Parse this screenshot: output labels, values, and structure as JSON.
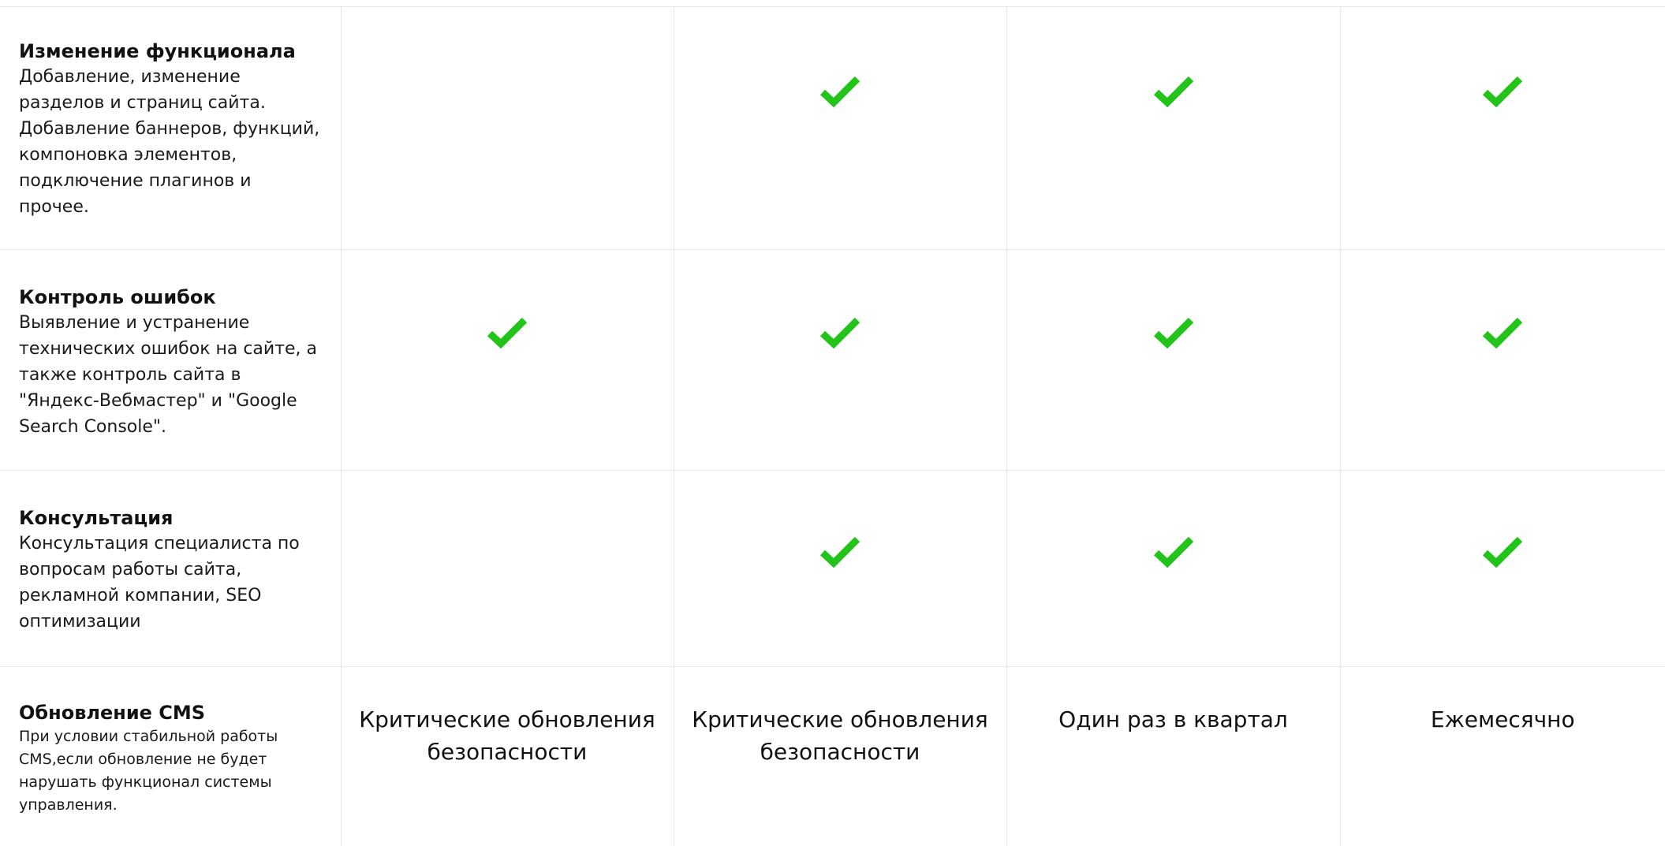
{
  "table": {
    "rows": [
      {
        "title": "Изменение функционала",
        "description": "Добавление, изменение разделов и страниц сайта. Добавление баннеров, функций, компоновка элементов, подключение плагинов и прочее.",
        "cells": [
          "",
          "check",
          "check",
          "check"
        ]
      },
      {
        "title": "Контроль ошибок",
        "description": "Выявление и устранение технических ошибок на сайте, а также контроль сайта в \"Яндекс-Вебмастер\" и \"Google Search Console\".",
        "cells": [
          "check",
          "check",
          "check",
          "check"
        ]
      },
      {
        "title": "Консультация",
        "description": "Консультация специалиста по вопросам работы сайта, рекламной компании, SEO оптимизации",
        "cells": [
          "",
          "check",
          "check",
          "check"
        ]
      },
      {
        "title": "Обновление CMS",
        "description": "При условии стабильной работы CMS,если обновление не будет нарушать функционал системы управления.",
        "cells": [
          "Критические обновления безопасности",
          "Критические обновления безопасности",
          "Один раз в квартал",
          "Ежемесячно"
        ]
      }
    ],
    "check_icon": "checkmark-icon",
    "check_color": "#22c41a"
  }
}
